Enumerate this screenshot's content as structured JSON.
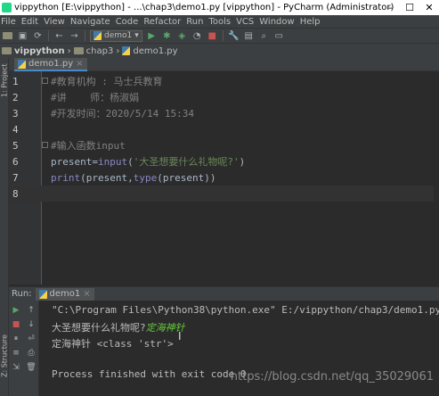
{
  "window": {
    "title": "vippython [E:\\vippython] - ...\\chap3\\demo1.py [vippython] - PyCharm (Administrator)",
    "minimize": "–",
    "maximize": "☐",
    "close": "✕"
  },
  "menu": [
    "File",
    "Edit",
    "View",
    "Navigate",
    "Code",
    "Refactor",
    "Run",
    "Tools",
    "VCS",
    "Window",
    "Help"
  ],
  "toolbar": {
    "run_config": "demo1"
  },
  "breadcrumb": {
    "project": "vippython",
    "folder": "chap3",
    "file": "demo1.py"
  },
  "side_tabs": {
    "project": "1: Project",
    "structure": "Z: Structure",
    "favorites": "2: Favorites"
  },
  "editor": {
    "tab": "demo1.py",
    "lines": [
      {
        "n": "1",
        "parts": [
          {
            "t": "#教育机构 : 马士兵教育",
            "c": "comment"
          }
        ]
      },
      {
        "n": "2",
        "parts": [
          {
            "t": "#讲    师：杨淑娟",
            "c": "comment"
          }
        ]
      },
      {
        "n": "3",
        "parts": [
          {
            "t": "#开发时间：2020/5/14 15:34",
            "c": "comment"
          }
        ]
      },
      {
        "n": "4",
        "parts": []
      },
      {
        "n": "5",
        "parts": [
          {
            "t": "#输入函数input",
            "c": "comment"
          }
        ]
      },
      {
        "n": "6",
        "parts": [
          {
            "t": "present",
            "c": "plain"
          },
          {
            "t": "=",
            "c": "plain"
          },
          {
            "t": "input",
            "c": "kw"
          },
          {
            "t": "(",
            "c": "plain"
          },
          {
            "t": "'大圣想要什么礼物呢?'",
            "c": "str"
          },
          {
            "t": ")",
            "c": "plain"
          }
        ]
      },
      {
        "n": "7",
        "parts": [
          {
            "t": "print",
            "c": "kw"
          },
          {
            "t": "(present,",
            "c": "plain"
          },
          {
            "t": "type",
            "c": "kw"
          },
          {
            "t": "(present))",
            "c": "plain"
          }
        ]
      },
      {
        "n": "8",
        "parts": []
      }
    ]
  },
  "run_panel": {
    "label": "Run:",
    "tab": "demo1",
    "lines": {
      "cmd": "\"C:\\Program Files\\Python38\\python.exe\" E:/vippython/chap3/demo1.py",
      "prompt": "大圣想要什么礼物呢?",
      "user_input": "定海神针",
      "result": "定海神针 <class 'str'>",
      "finished": "Process finished with exit code 0"
    },
    "watermark": "https://blog.csdn.net/qq_35029061"
  }
}
